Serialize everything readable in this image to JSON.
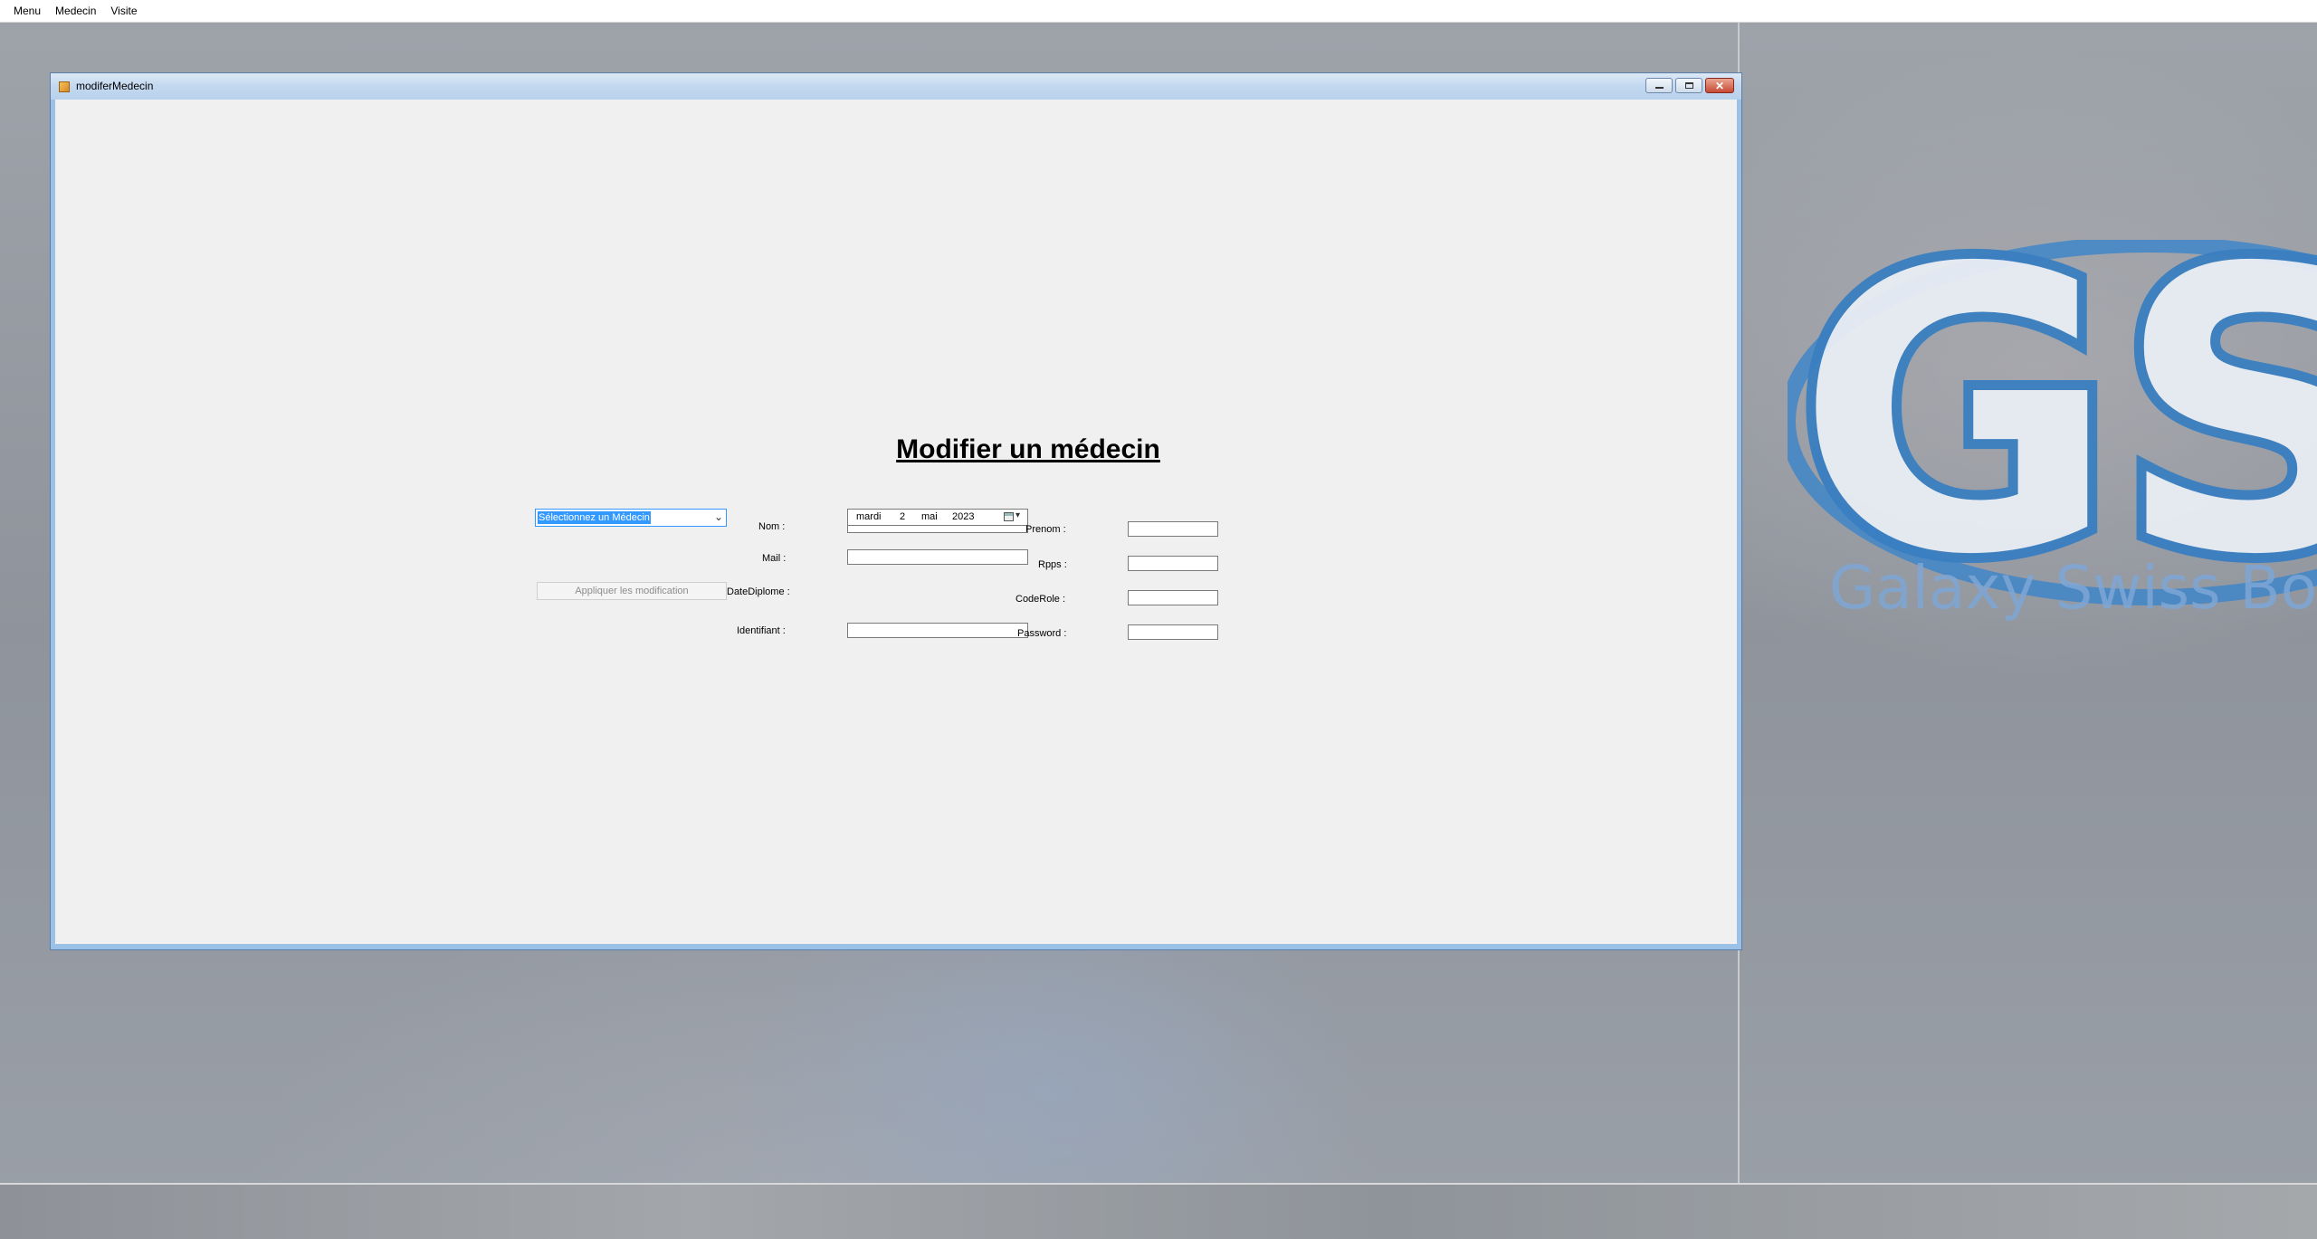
{
  "menubar": {
    "items": [
      "Menu",
      "Medecin",
      "Visite"
    ]
  },
  "background": {
    "logo_text": "GSB",
    "logo_tagline": "Galaxy Swiss Bourdin",
    "logo_color": "#2f73b5"
  },
  "window": {
    "title": "modiferMedecin"
  },
  "form": {
    "heading": "Modifier un médecin",
    "select_medecin": "Sélectionnez un Médecin",
    "apply_button": "Appliquer les modification",
    "labels": {
      "nom": "Nom :",
      "mail": "Mail :",
      "date_diplome": "DateDiplome :",
      "identifiant": "Identifiant :",
      "prenom": "Prenom :",
      "rpps": "Rpps :",
      "code_role": "CodeRole :",
      "password": "Password :"
    },
    "values": {
      "nom": "",
      "mail": "",
      "identifiant": "",
      "prenom": "",
      "rpps": "",
      "code_role": "",
      "password": ""
    },
    "date": {
      "weekday": "mardi",
      "day": "2",
      "month": "mai",
      "year": "2023"
    }
  }
}
